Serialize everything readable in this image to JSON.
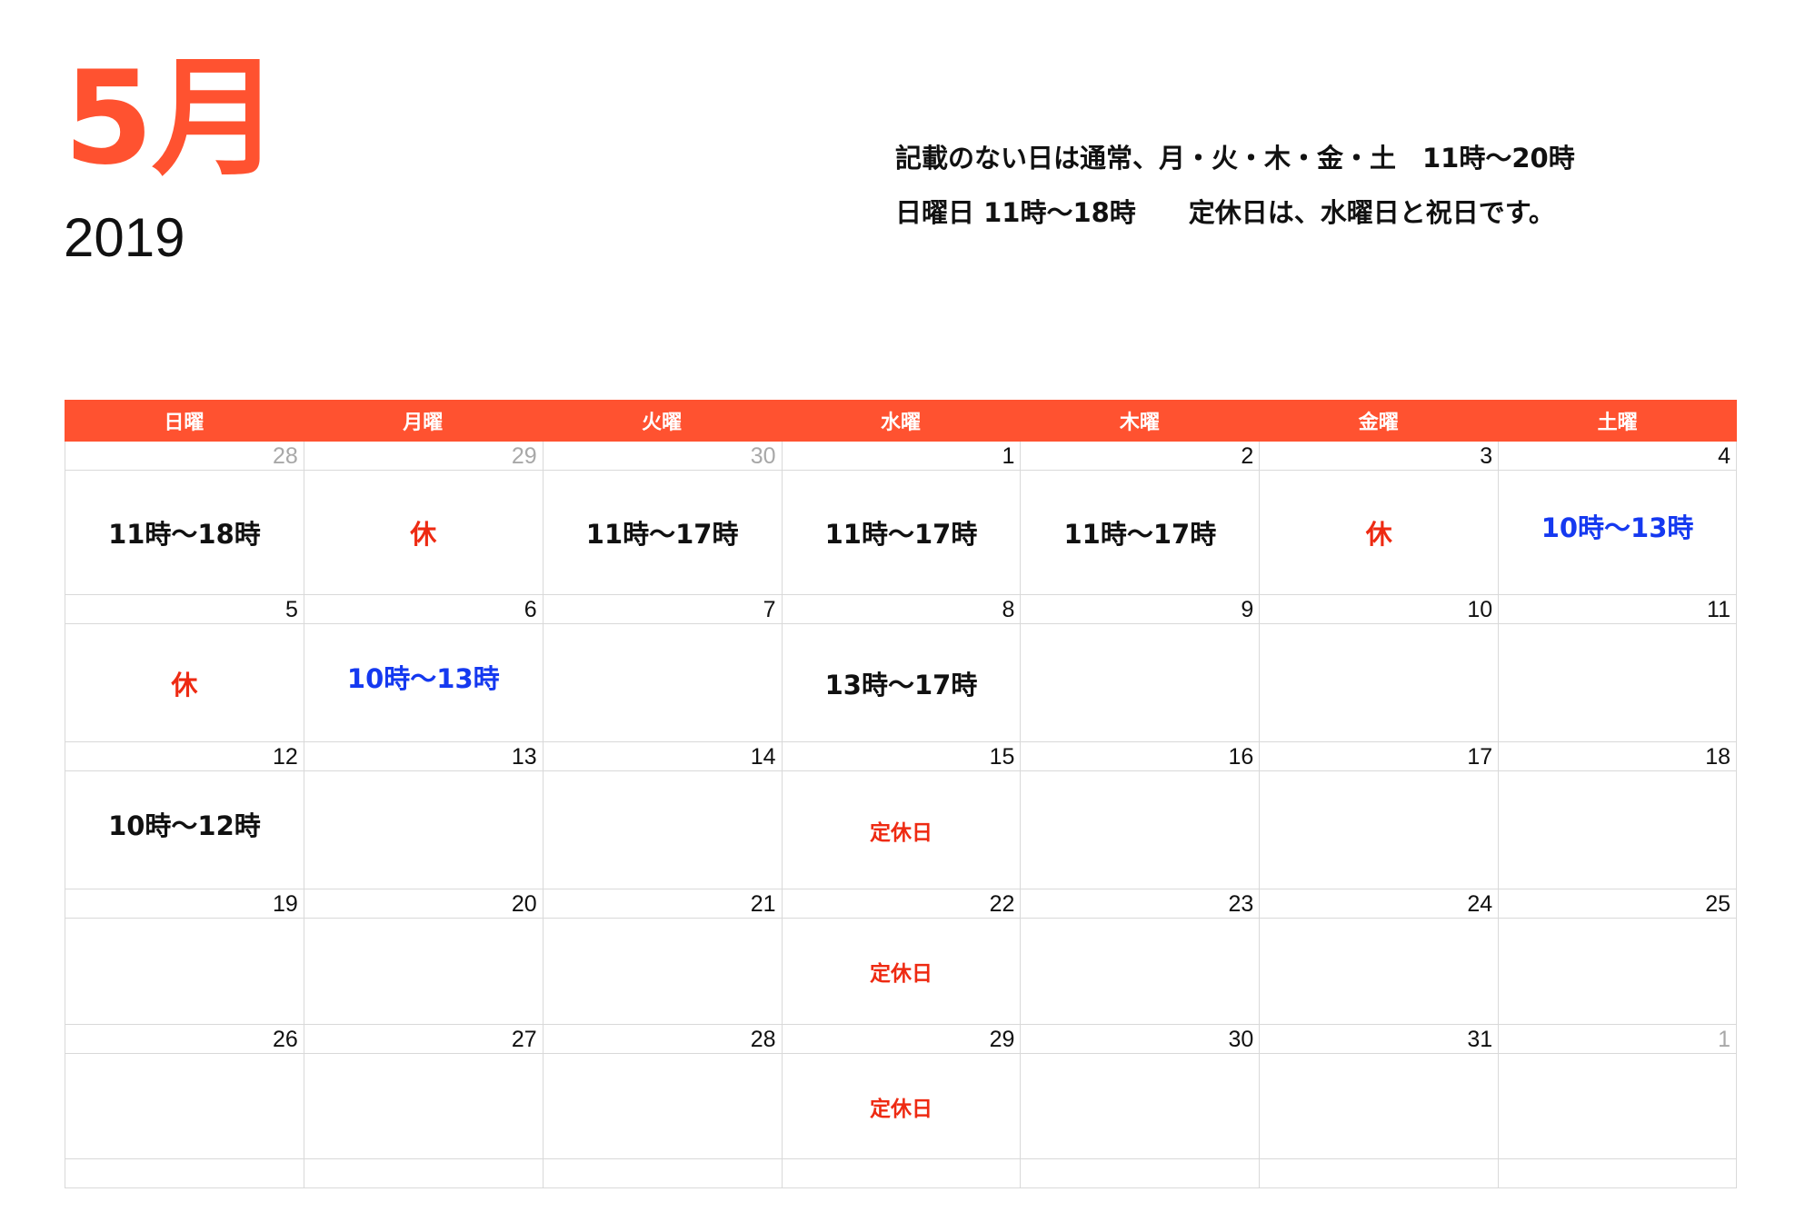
{
  "title": {
    "month": "5月",
    "year": "2019"
  },
  "notes": {
    "line1": "記載のない日は通常、月・火・木・金・土　11時〜20時",
    "line2": "日曜日 11時〜18時　　定休日は、水曜日と祝日です。"
  },
  "colors": {
    "accent": "#ff5230",
    "closed_red": "#ee2a12",
    "special_blue": "#1539f0",
    "muted_date": "#a8a8a8"
  },
  "weekdays": [
    "日曜",
    "月曜",
    "火曜",
    "水曜",
    "木曜",
    "金曜",
    "土曜"
  ],
  "weeks": [
    [
      {
        "day": "28",
        "muted": true,
        "note": "11時〜18時",
        "color": "black"
      },
      {
        "day": "29",
        "muted": true,
        "note": "休",
        "color": "red"
      },
      {
        "day": "30",
        "muted": true,
        "note": "11時〜17時",
        "color": "black"
      },
      {
        "day": "1",
        "note": "11時〜17時",
        "color": "black"
      },
      {
        "day": "2",
        "note": "11時〜17時",
        "color": "black"
      },
      {
        "day": "3",
        "note": "休",
        "color": "red"
      },
      {
        "day": "4",
        "note": "10時〜13時",
        "color": "blue",
        "raised": true
      }
    ],
    [
      {
        "day": "5",
        "note": "休",
        "color": "red"
      },
      {
        "day": "6",
        "note": "10時〜13時",
        "color": "blue",
        "raised": true
      },
      {
        "day": "7",
        "note": ""
      },
      {
        "day": "8",
        "note": "13時〜17時",
        "color": "black"
      },
      {
        "day": "9",
        "note": ""
      },
      {
        "day": "10",
        "note": ""
      },
      {
        "day": "11",
        "note": ""
      }
    ],
    [
      {
        "day": "12",
        "note": "10時〜12時",
        "color": "black",
        "raised": true
      },
      {
        "day": "13",
        "note": ""
      },
      {
        "day": "14",
        "note": ""
      },
      {
        "day": "15",
        "note": "定休日",
        "color": "red",
        "small": true
      },
      {
        "day": "16",
        "note": ""
      },
      {
        "day": "17",
        "note": ""
      },
      {
        "day": "18",
        "note": ""
      }
    ],
    [
      {
        "day": "19",
        "note": ""
      },
      {
        "day": "20",
        "note": ""
      },
      {
        "day": "21",
        "note": ""
      },
      {
        "day": "22",
        "note": "定休日",
        "color": "red",
        "small": true
      },
      {
        "day": "23",
        "note": ""
      },
      {
        "day": "24",
        "note": ""
      },
      {
        "day": "25",
        "note": ""
      }
    ],
    [
      {
        "day": "26",
        "note": ""
      },
      {
        "day": "27",
        "note": ""
      },
      {
        "day": "28",
        "note": ""
      },
      {
        "day": "29",
        "note": "定休日",
        "color": "red",
        "small": true
      },
      {
        "day": "30",
        "note": ""
      },
      {
        "day": "31",
        "note": ""
      },
      {
        "day": "1",
        "muted": true,
        "note": ""
      }
    ]
  ]
}
